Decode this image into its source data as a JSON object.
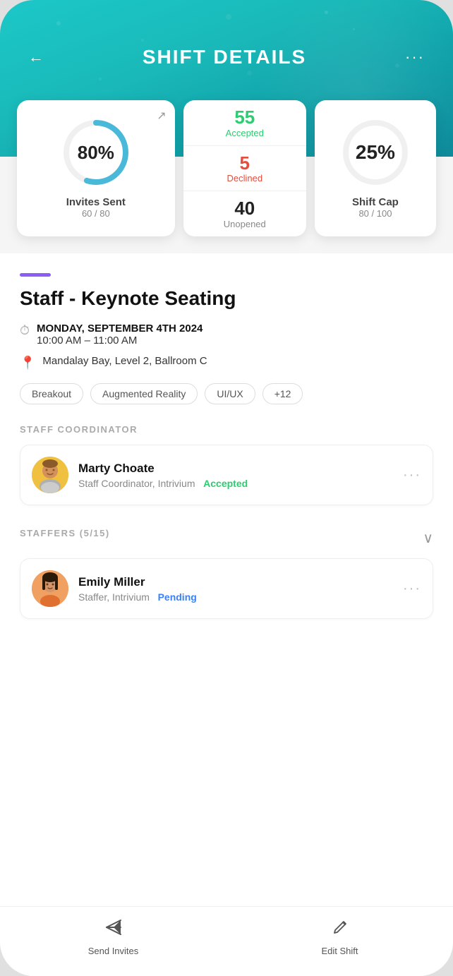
{
  "header": {
    "title": "SHIFT DETAILS",
    "back_label": "←",
    "more_label": "···"
  },
  "stats": {
    "main_card": {
      "percent": "80%",
      "label": "Invites Sent",
      "sublabel": "60 / 80",
      "expand_icon": "↗"
    },
    "right_card": {
      "items": [
        {
          "num": "55",
          "status": "Accepted",
          "color": "green"
        },
        {
          "num": "5",
          "status": "Declined",
          "color": "red"
        },
        {
          "num": "40",
          "status": "Unopened",
          "color": "dark"
        }
      ]
    },
    "cap_card": {
      "num": "25%",
      "label": "Shift Cap",
      "sublabel": "80 / 100"
    }
  },
  "shift": {
    "accent_color": "#8b5cf6",
    "title": "Staff - Keynote Seating",
    "date": "MONDAY, SEPTEMBER 4TH 2024",
    "time": "10:00 AM – 11:00 AM",
    "location": "Mandalay Bay, Level 2, Ballroom C",
    "tags": [
      "Breakout",
      "Augmented Reality",
      "UI/UX",
      "+12"
    ]
  },
  "coordinator_section": {
    "label": "STAFF COORDINATOR",
    "person": {
      "name": "Marty Choate",
      "role": "Staff Coordinator, Intrivium",
      "status": "Accepted",
      "status_color": "green"
    }
  },
  "staffers_section": {
    "label": "STAFFERS (5/15)",
    "person": {
      "name": "Emily Miller",
      "role": "Staffer, Intrivium",
      "status": "Pending",
      "status_color": "blue"
    }
  },
  "bottom_nav": {
    "items": [
      {
        "icon": "send",
        "label": "Send Invites"
      },
      {
        "icon": "edit",
        "label": "Edit Shift"
      }
    ]
  }
}
